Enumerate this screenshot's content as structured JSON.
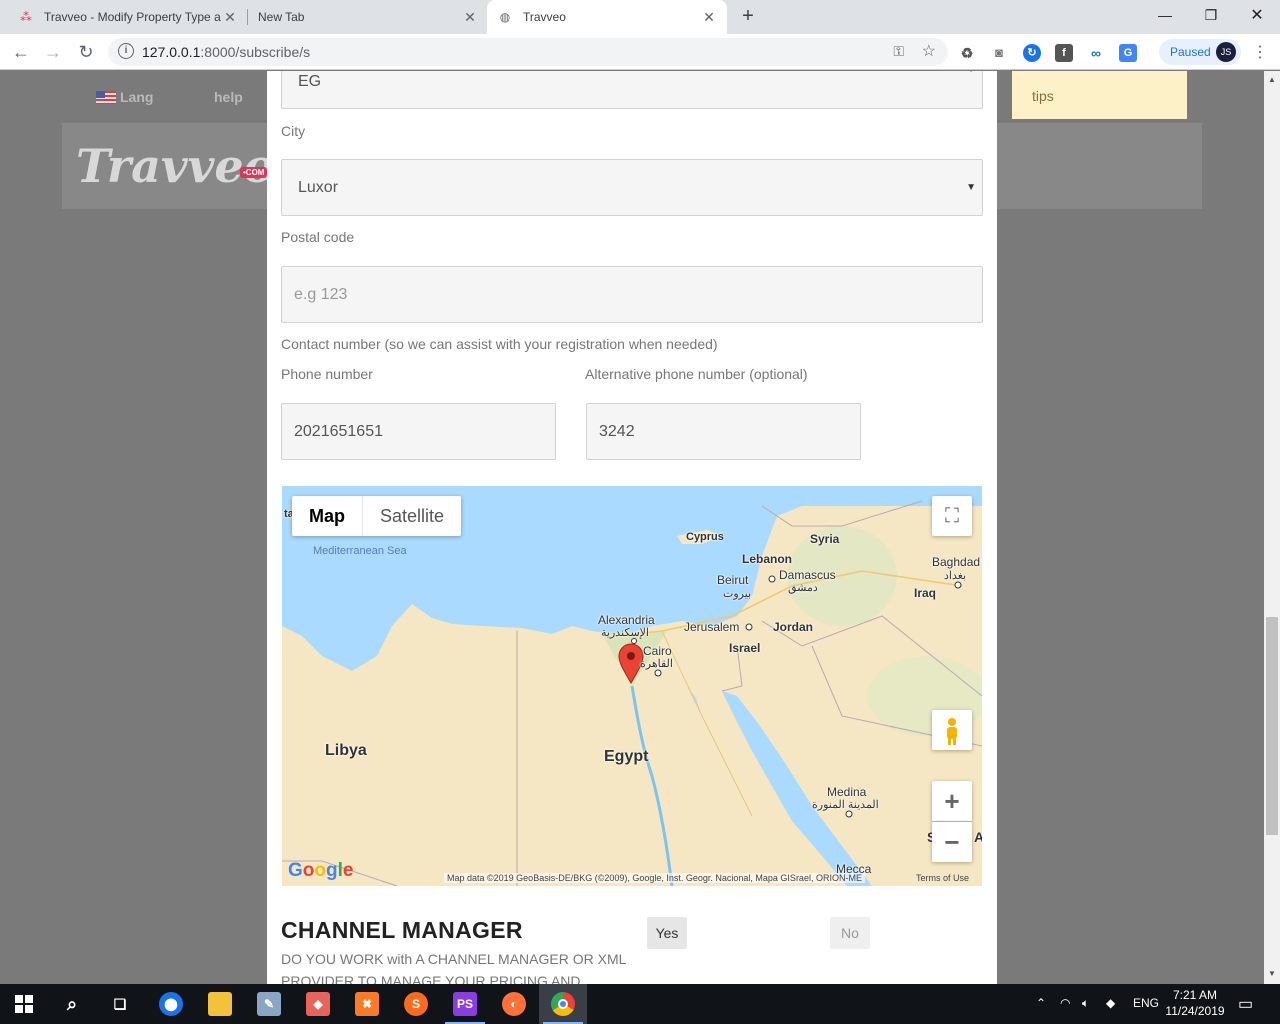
{
  "browser": {
    "tabs": [
      {
        "title": "Travveo - Modify Property Type a"
      },
      {
        "title": "New Tab"
      },
      {
        "title": "Travveo"
      }
    ],
    "new_tab_symbol": "+",
    "url_host": "127.0.0.1",
    "url_path": ":8000/subscribe/s",
    "profile_status": "Paused",
    "profile_initials": "JS"
  },
  "site": {
    "lang_label": "Lang",
    "help_label": "help",
    "logo_text": "Travveo",
    "logo_suffix": "•COM",
    "tips_label": "tips"
  },
  "form": {
    "country_value": "EG",
    "city_label": "City",
    "city_value": "Luxor",
    "postal_label": "Postal code",
    "postal_placeholder": "e.g 123",
    "contact_heading": "Contact number (so we can assist with your registration when needed)",
    "phone_label": "Phone number",
    "phone_value": "2021651651",
    "alt_phone_label": "Alternative phone number (optional)",
    "alt_phone_value": "3242"
  },
  "map": {
    "type_map": "Map",
    "type_satellite": "Satellite",
    "labels": {
      "sea": "Mediterranean Sea",
      "cyprus": "Cyprus",
      "syria": "Syria",
      "lebanon": "Lebanon",
      "beirut": "Beirut",
      "beirut_ar": "بيروت",
      "damascus": "Damascus",
      "damascus_ar": "دمشق",
      "baghdad": "Baghdad",
      "baghdad_ar": "بغداد",
      "iraq": "Iraq",
      "alexandria": "Alexandria",
      "alexandria_ar": "الإسكندرية",
      "jerusalem": "Jerusalem",
      "jordan": "Jordan",
      "israel": "Israel",
      "cairo": "Cairo",
      "cairo_ar": "القاهرة",
      "libya": "Libya",
      "egypt": "Egypt",
      "medina": "Medina",
      "medina_ar": "المدينة المنورة",
      "mecca": "Mecca",
      "edge_left": "ta",
      "edge_s": "S",
      "edge_a": "A"
    },
    "attribution": "Map data ©2019 GeoBasis-DE/BKG (©2009), Google, Inst. Geogr. Nacional, Mapa GISrael, ORION-ME",
    "terms": "Terms of Use",
    "google_logo": "Google",
    "zoom_in": "+",
    "zoom_out": "−"
  },
  "channel_manager": {
    "title": "CHANNEL MANAGER",
    "description": "DO YOU WORK with A CHANNEL MANAGER OR XML PROVIDER TO MANAGE YOUR PRICING AND",
    "yes_label": "Yes",
    "no_label": "No"
  },
  "taskbar": {
    "tray_lang": "ENG",
    "time": "7:21 AM",
    "date": "11/24/2019"
  },
  "colors": {
    "accent_red": "#e2335a",
    "tips_bg": "#fdf1c8",
    "water": "#aadaff"
  }
}
